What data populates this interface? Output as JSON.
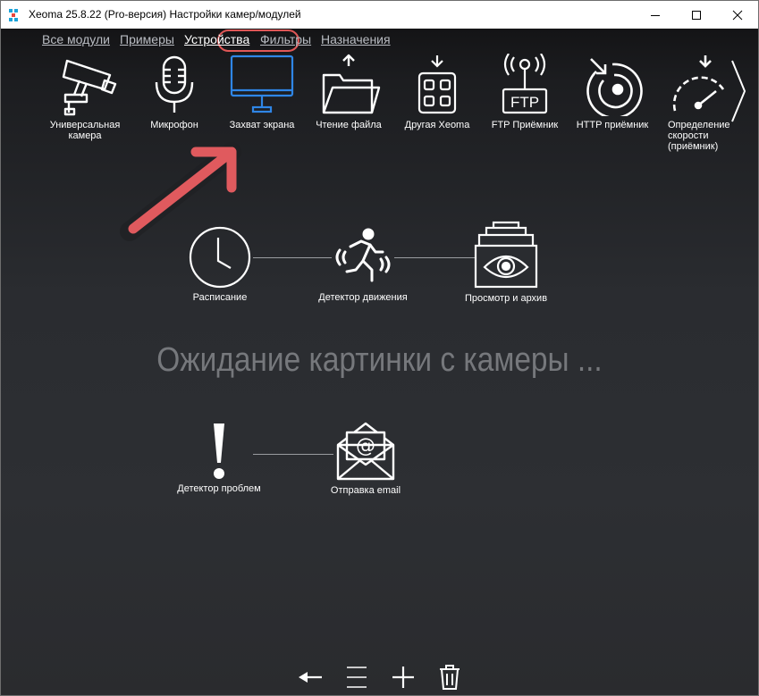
{
  "window": {
    "title": "Xeoma 25.8.22 (Pro-версия) Настройки камер/модулей",
    "controls": [
      "minimize",
      "maximize",
      "close"
    ]
  },
  "nav": {
    "items": [
      {
        "label": "Все модули",
        "active": false
      },
      {
        "label": "Примеры",
        "active": false
      },
      {
        "label": "Устройства",
        "active": true
      },
      {
        "label": "Фильтры",
        "active": false
      },
      {
        "label": "Назначения",
        "active": false
      }
    ],
    "highlight_color": "#e05757"
  },
  "modules": [
    {
      "label": "Универсальная камера",
      "icon": "cctv-camera-icon",
      "selected": false
    },
    {
      "label": "Микрофон",
      "icon": "microphone-icon",
      "selected": false
    },
    {
      "label": "Захват экрана",
      "icon": "monitor-icon",
      "selected": true
    },
    {
      "label": "Чтение файла",
      "icon": "folder-upload-icon",
      "selected": false
    },
    {
      "label": "Другая Xeoma",
      "icon": "grid-device-icon",
      "selected": false
    },
    {
      "label": "FTP Приёмник",
      "icon": "ftp-antenna-icon",
      "selected": false
    },
    {
      "label": "HTTP приёмник",
      "icon": "http-target-icon",
      "selected": false
    },
    {
      "label": "Определение скорости (приёмник)",
      "icon": "speedometer-icon",
      "selected": false
    }
  ],
  "chain1": {
    "nodes": [
      {
        "label": "Расписание",
        "icon": "clock-icon"
      },
      {
        "label": "Детектор движения",
        "icon": "running-man-icon"
      },
      {
        "label": "Просмотр и архив",
        "icon": "eye-archive-icon"
      }
    ]
  },
  "status": {
    "waiting_text": "Ожидание картинки с камеры ..."
  },
  "chain2": {
    "nodes": [
      {
        "label": "Детектор проблем",
        "icon": "exclamation-icon"
      },
      {
        "label": "Отправка email",
        "icon": "email-envelope-icon"
      }
    ]
  },
  "toolbar": {
    "buttons": [
      "back-arrow-icon",
      "menu-lines-icon",
      "plus-icon",
      "trash-icon"
    ]
  },
  "colors": {
    "selected_module": "#2f86e6",
    "callout_arrow": "#e05a5e",
    "link_line": "#9a9ca0"
  }
}
